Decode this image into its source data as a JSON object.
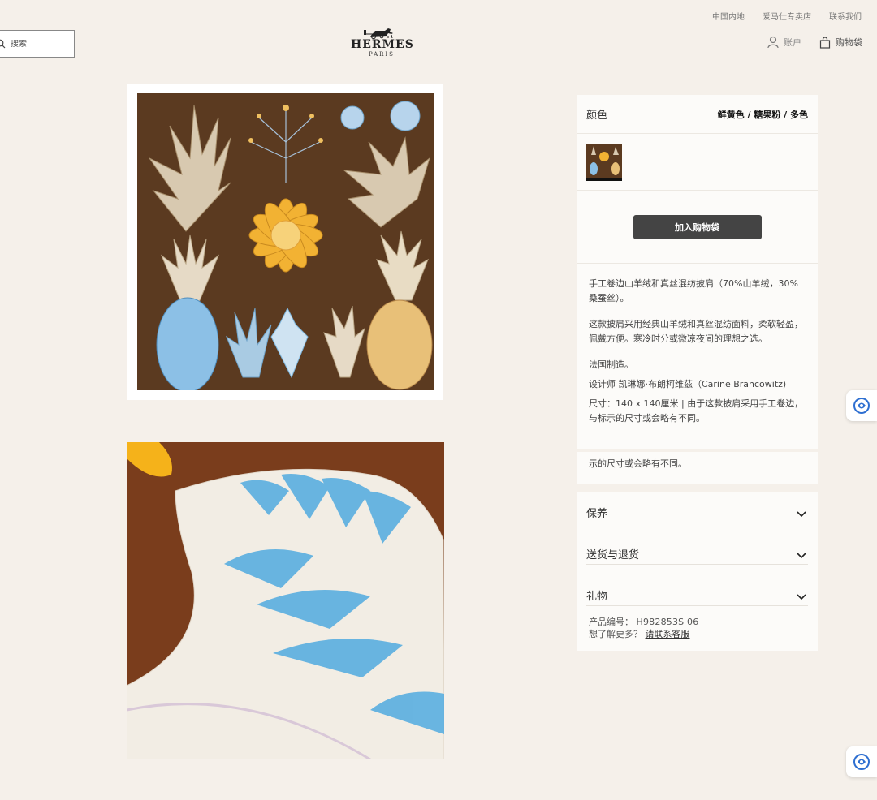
{
  "top_links": [
    "中国内地",
    "爱马仕专卖店",
    "联系我们"
  ],
  "search": {
    "placeholder": "搜索"
  },
  "logo": {
    "brand": "HERMES",
    "city": "PARIS"
  },
  "user_nav": {
    "account": "账户",
    "bag": "购物袋"
  },
  "product": {
    "color_label": "颜色",
    "color_value": "鲜黄色 / 糖果粉 / 多色",
    "add_to_bag": "加入购物袋",
    "description": [
      "手工卷边山羊绒和真丝混纺披肩（70%山羊绒，30%桑蚕丝）。",
      "这款披肩采用经典山羊绒和真丝混纺面料，柔软轻盈，佩戴方便。寒冷时分或微凉夜间的理想之选。",
      "法国制造。",
      "设计师 凯琳娜·布朗柯维茲（Carine Brancowitz)",
      "尺寸：140 x 140厘米 | 由于这款披肩采用手工卷边，与标示的尺寸或会略有不同。"
    ],
    "overflow_text": "示的尺寸或会略有不同。",
    "accordion": [
      "保养",
      "送货与退货",
      "礼物"
    ],
    "product_code_label": "产品编号：",
    "product_code": "H982853S 06",
    "more_info_label": "想了解更多？",
    "contact_link": "请联系客服"
  },
  "colors": {
    "background": "#f5f0ea",
    "panel": "#fcfbf9",
    "button": "#444444",
    "scarf_brown": "#5b3a20",
    "scarf_yellow": "#f2b233",
    "scarf_blue": "#7fb8e0"
  },
  "icons": [
    "search-icon",
    "hermes-carriage-logo",
    "account-icon",
    "shopping-bag-icon",
    "chevron-down-icon",
    "chat-widget-icon"
  ]
}
